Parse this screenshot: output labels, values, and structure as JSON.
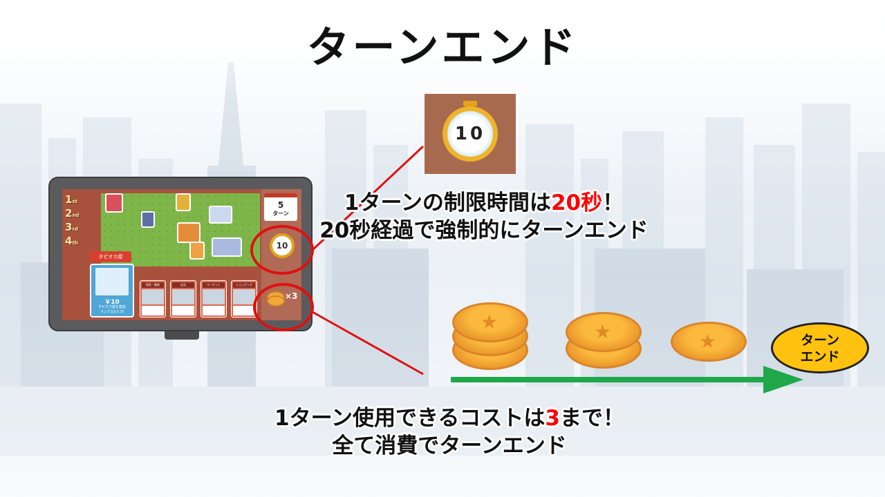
{
  "title": "ターンエンド",
  "tablet": {
    "ranks": [
      "1",
      "2",
      "3",
      "4"
    ],
    "rank_suffix": [
      "st",
      "nd",
      "rd",
      "th"
    ],
    "turn_number": "5",
    "turn_label": "ターン",
    "timer_value": "10",
    "cost_count": "×3",
    "shop_label": "タピオカ屋",
    "shop_price": "￥10",
    "shop_desc_1": "タピオカ屋を建設",
    "shop_desc_2": "ランク2は￥25",
    "cards": [
      {
        "head": "研究・開発"
      },
      {
        "head": "広告"
      },
      {
        "head": "マーケット"
      },
      {
        "head": "ショッピング"
      }
    ],
    "card_price": "￥10"
  },
  "timer": {
    "value": "10"
  },
  "timer_message": {
    "line1_pre": "1ターンの制限時間は",
    "line1_highlight": "20秒",
    "line1_post": "！",
    "line2": "20秒経過で強制的にターンエンド"
  },
  "cost_message": {
    "line1_pre": "1ターン使用できるコストは",
    "line1_highlight": "3",
    "line1_post": "まで！",
    "line2": "全て消費でターンエンド"
  },
  "end_badge": {
    "line1": "ターン",
    "line2": "エンド"
  },
  "colors": {
    "highlight": "#ff0000",
    "arrow": "#1ea84a",
    "badge": "#ffc20e",
    "coin": "#f2a93a",
    "ring": "#e01010"
  }
}
